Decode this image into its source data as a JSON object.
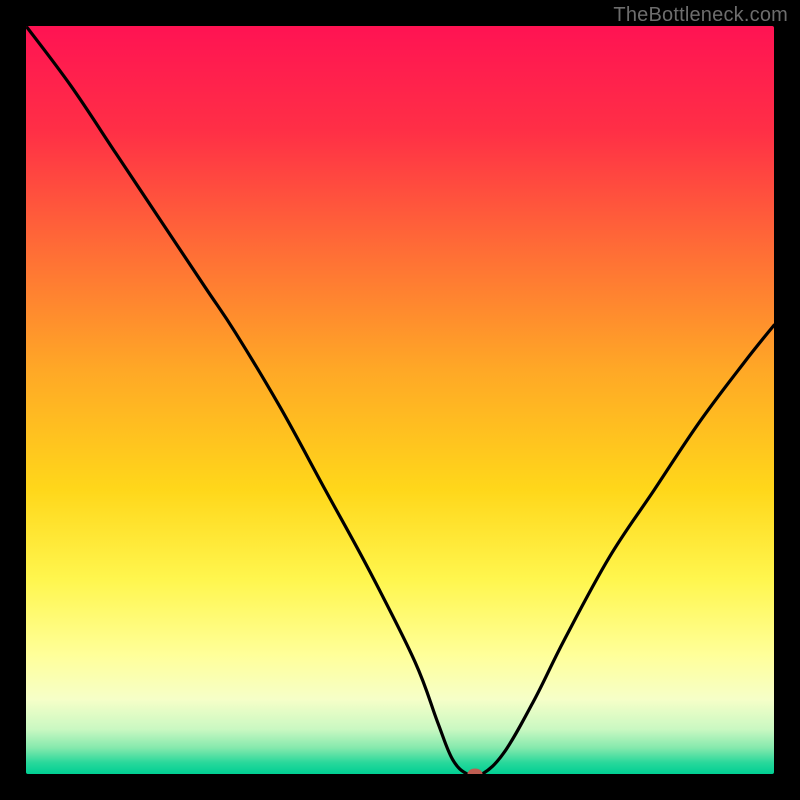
{
  "watermark": {
    "text": "TheBottleneck.com"
  },
  "chart_data": {
    "type": "line",
    "title": "",
    "xlabel": "",
    "ylabel": "",
    "xlim": [
      0,
      100
    ],
    "ylim": [
      0,
      100
    ],
    "gradient_stops": [
      {
        "offset": 0,
        "color": "#ff1353"
      },
      {
        "offset": 0.14,
        "color": "#ff2f46"
      },
      {
        "offset": 0.3,
        "color": "#ff6d36"
      },
      {
        "offset": 0.46,
        "color": "#ffa826"
      },
      {
        "offset": 0.62,
        "color": "#ffd71a"
      },
      {
        "offset": 0.74,
        "color": "#fff64e"
      },
      {
        "offset": 0.84,
        "color": "#ffff99"
      },
      {
        "offset": 0.9,
        "color": "#f6ffc8"
      },
      {
        "offset": 0.94,
        "color": "#caf8c2"
      },
      {
        "offset": 0.965,
        "color": "#85e9ad"
      },
      {
        "offset": 0.985,
        "color": "#28d89b"
      },
      {
        "offset": 1.0,
        "color": "#00cf93"
      }
    ],
    "series": [
      {
        "name": "bottleneck-curve",
        "x": [
          0,
          6,
          12,
          18,
          24,
          28,
          34,
          40,
          46,
          52,
          55,
          57,
          59,
          61,
          64,
          68,
          72,
          78,
          84,
          90,
          96,
          100
        ],
        "y": [
          100,
          92,
          83,
          74,
          65,
          59,
          49,
          38,
          27,
          15,
          7,
          2,
          0,
          0,
          3,
          10,
          18,
          29,
          38,
          47,
          55,
          60
        ]
      }
    ],
    "marker": {
      "x": 60,
      "y": 0,
      "color": "#be5d52"
    },
    "plateau": {
      "x_start": 57,
      "x_end": 61,
      "y": 0
    }
  }
}
